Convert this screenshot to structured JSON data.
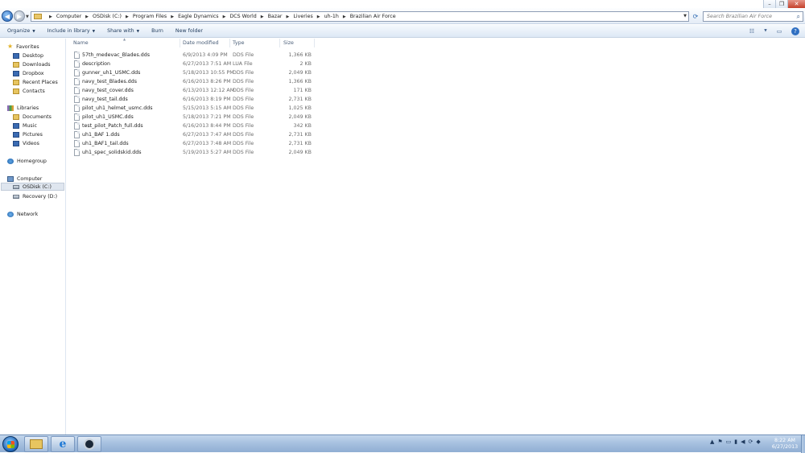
{
  "window": {
    "caption": {
      "minimize_icon": "minimize-icon",
      "maximize_icon": "restore-icon",
      "close_icon": "close-icon"
    }
  },
  "address_bar": {
    "breadcrumbs": [
      "Computer",
      "OSDisk (C:)",
      "Program Files",
      "Eagle Dynamics",
      "DCS World",
      "Bazar",
      "Liveries",
      "uh-1h",
      "Brazilian Air Force"
    ],
    "search_placeholder": "Search Brazilian Air Force"
  },
  "command_bar": {
    "organize": "Organize",
    "include_in_library": "Include in library",
    "share_with": "Share with",
    "burn": "Burn",
    "new_folder": "New folder"
  },
  "nav_pane": {
    "favorites": {
      "label": "Favorites",
      "items": [
        "Desktop",
        "Downloads",
        "Dropbox",
        "Recent Places",
        "Contacts"
      ]
    },
    "libraries": {
      "label": "Libraries",
      "items": [
        "Documents",
        "Music",
        "Pictures",
        "Videos"
      ]
    },
    "homegroup": "Homegroup",
    "computer": {
      "label": "Computer",
      "items": [
        "OSDisk (C:)",
        "Recovery (D:)"
      ]
    },
    "network": "Network"
  },
  "file_list": {
    "columns": [
      "Name",
      "Date modified",
      "Type",
      "Size"
    ],
    "rows": [
      {
        "name": "57th_medevac_Blades.dds",
        "date": "6/9/2013 4:09 PM",
        "type": "DDS File",
        "size": "1,366 KB"
      },
      {
        "name": "description",
        "date": "6/27/2013 7:51 AM",
        "type": "LUA File",
        "size": "2 KB"
      },
      {
        "name": "gunner_uh1_USMC.dds",
        "date": "5/18/2013 10:55 PM",
        "type": "DDS File",
        "size": "2,049 KB"
      },
      {
        "name": "navy_test_Blades.dds",
        "date": "6/16/2013 8:26 PM",
        "type": "DDS File",
        "size": "1,366 KB"
      },
      {
        "name": "navy_test_cover.dds",
        "date": "6/13/2013 12:12 AM",
        "type": "DDS File",
        "size": "171 KB"
      },
      {
        "name": "navy_test_tail.dds",
        "date": "6/16/2013 8:19 PM",
        "type": "DDS File",
        "size": "2,731 KB"
      },
      {
        "name": "pilot_uh1_helmet_usmc.dds",
        "date": "5/15/2013 5:15 AM",
        "type": "DDS File",
        "size": "1,025 KB"
      },
      {
        "name": "pilot_uh1_USMC.dds",
        "date": "5/18/2013 7:21 PM",
        "type": "DDS File",
        "size": "2,049 KB"
      },
      {
        "name": "test_pilot_Patch_full.dds",
        "date": "6/16/2013 8:44 PM",
        "type": "DDS File",
        "size": "342 KB"
      },
      {
        "name": "uh1_BAF 1.dds",
        "date": "6/27/2013 7:47 AM",
        "type": "DDS File",
        "size": "2,731 KB"
      },
      {
        "name": "uh1_BAF1_tail.dds",
        "date": "6/27/2013 7:48 AM",
        "type": "DDS File",
        "size": "2,731 KB"
      },
      {
        "name": "uh1_spec_solidskid.dds",
        "date": "5/19/2013 5:27 AM",
        "type": "DDS File",
        "size": "2,049 KB"
      }
    ]
  },
  "taskbar": {
    "pinned": [
      "windows-explorer-icon",
      "internet-explorer-icon",
      "steam-icon"
    ],
    "clock_time": "8:22 AM",
    "clock_date": "6/27/2013"
  }
}
